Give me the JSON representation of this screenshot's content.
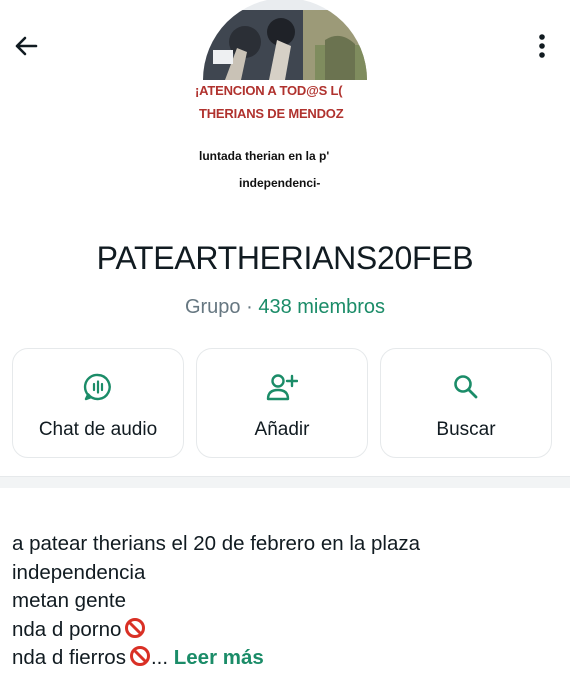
{
  "avatar": {
    "banner_line1": "¡ATENCION A TOD@S L(",
    "banner_line2": "THERIANS DE MENDOZ",
    "text_line1": "luntada therian en la p'",
    "text_line2": "independenci-"
  },
  "group": {
    "name": "PATEARTHERIANS20FEB",
    "type": "Grupo",
    "separator": " · ",
    "members": "438 miembros"
  },
  "actions": [
    {
      "label": "Chat de audio",
      "icon": "audio-chat-icon"
    },
    {
      "label": "Añadir",
      "icon": "add-person-icon"
    },
    {
      "label": "Buscar",
      "icon": "search-icon"
    }
  ],
  "description": {
    "lines": [
      "a patear therians el 20 de febrero en la plaza",
      "independencia",
      "metan gente",
      "nda d porno",
      "nda d fierros"
    ],
    "ellipsis": "...",
    "read_more": "Leer más"
  },
  "colors": {
    "accent": "#1b8c68",
    "banner_text": "#b0322e",
    "prohibited": "#d93025"
  }
}
